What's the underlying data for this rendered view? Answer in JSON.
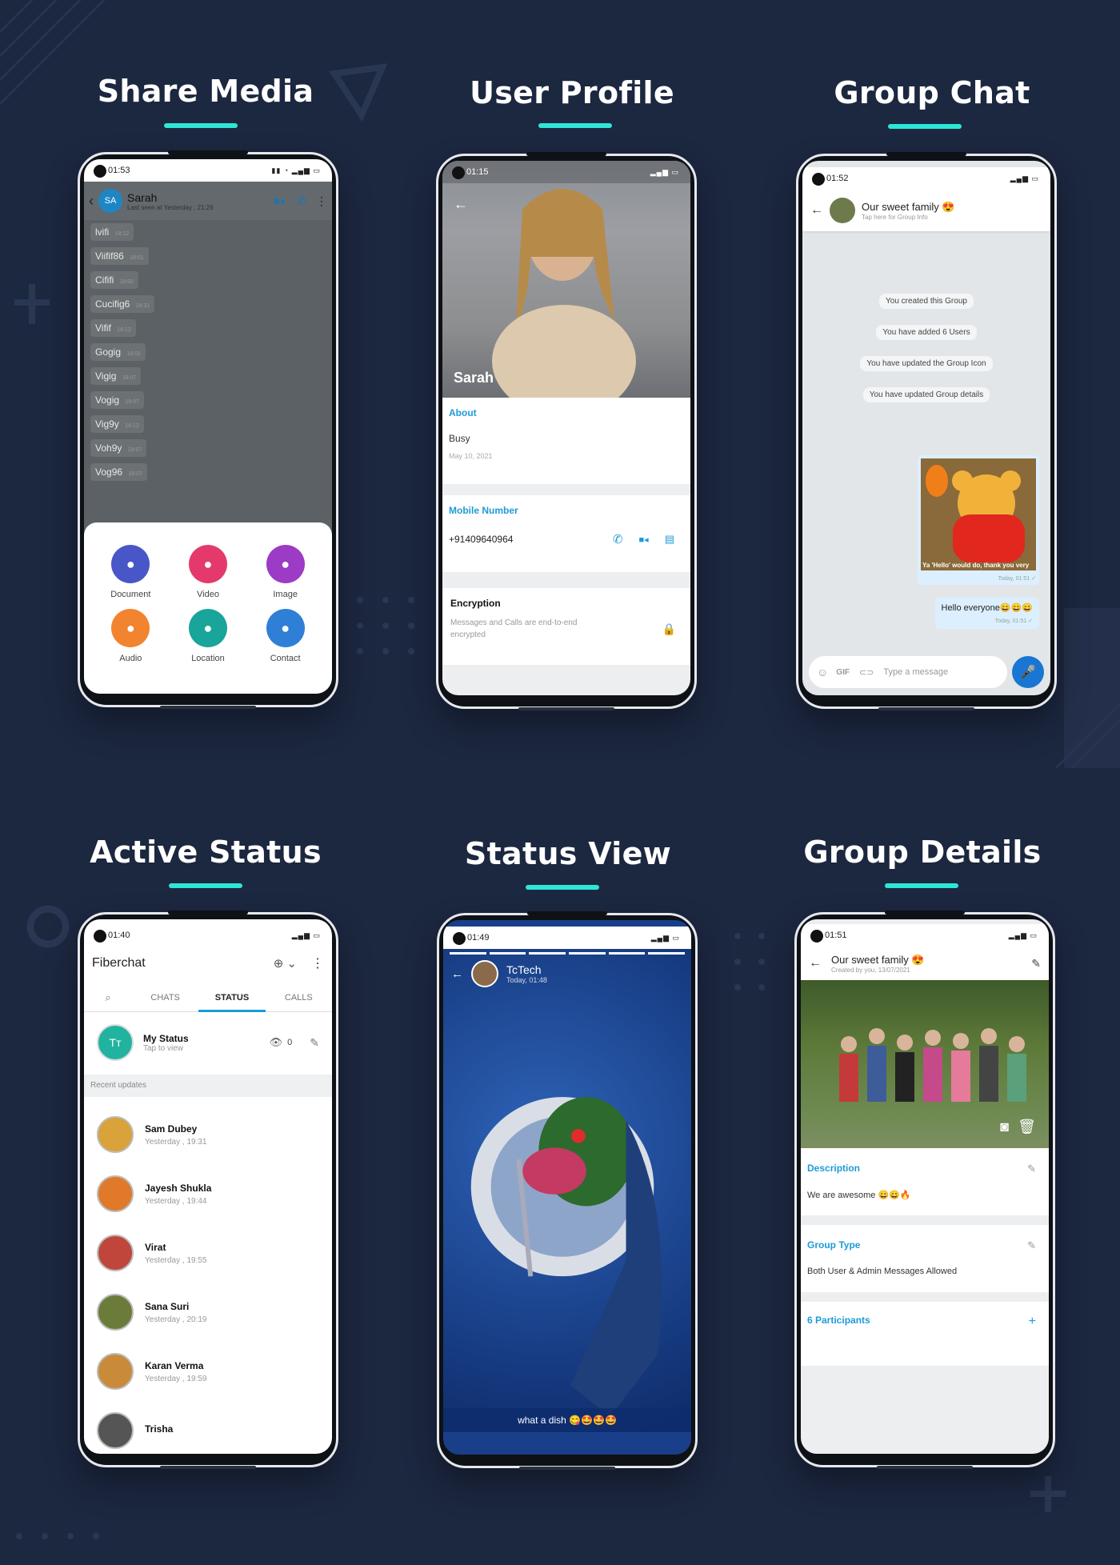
{
  "sections": {
    "share_media": "Share Media",
    "user_profile": "User Profile",
    "group_chat": "Group Chat",
    "active_status": "Active Status",
    "status_view": "Status View",
    "group_details": "Group Details"
  },
  "colors": {
    "background": "#1c2740",
    "accent_bar": "#2ee6d6",
    "app_blue": "#1e9bd7",
    "fab_blue": "#1976d2"
  },
  "share": {
    "time": "01:53",
    "avatar": "SA",
    "name": "Sarah",
    "last_seen": "Last seen at Yesterday , 21:26",
    "messages": [
      {
        "text": "lvifi",
        "time": "18:12"
      },
      {
        "text": "Viifif86",
        "time": "18:01"
      },
      {
        "text": "Cififi",
        "time": "18:02"
      },
      {
        "text": "Cucifig6",
        "time": "18:31"
      },
      {
        "text": "Vifif",
        "time": "18:12"
      },
      {
        "text": "Gogig",
        "time": "18:01"
      },
      {
        "text": "Vigig",
        "time": "18:07"
      },
      {
        "text": "Vogig",
        "time": "18:07"
      },
      {
        "text": "Vig9y",
        "time": "18:12"
      },
      {
        "text": "Voh9y",
        "time": "18:07"
      },
      {
        "text": "Vog96",
        "time": "18:07"
      }
    ],
    "attachments": [
      {
        "label": "Document",
        "icon": "document-icon",
        "color": "#4856c8"
      },
      {
        "label": "Video",
        "icon": "video-icon",
        "color": "#e43a6b"
      },
      {
        "label": "Image",
        "icon": "image-icon",
        "color": "#9c3bc6"
      },
      {
        "label": "Audio",
        "icon": "microphone-icon",
        "color": "#f2832f"
      },
      {
        "label": "Location",
        "icon": "location-pin-icon",
        "color": "#1aa59b"
      },
      {
        "label": "Contact",
        "icon": "contact-icon",
        "color": "#2f7fd6"
      }
    ]
  },
  "profile": {
    "time": "01:15",
    "name": "Sarah",
    "about_label": "About",
    "about_value": "Busy",
    "about_date": "May 10, 2021",
    "mobile_label": "Mobile Number",
    "mobile_value": "+91409640964",
    "encryption_label": "Encryption",
    "encryption_text": "Messages and Calls are end-to-end encrypted"
  },
  "group_chat": {
    "time": "01:52",
    "title": "Our sweet family 😍",
    "subtitle": "Tap here for Group Info",
    "events": [
      "You created this Group",
      "You have added 6 Users",
      "You have updated the Group Icon",
      "You have updated Group details"
    ],
    "image_caption": "Ya 'Hello' would do, thank you very",
    "image_time": "Today, 01:51 ✓",
    "message": "Hello everyone😄😄😄",
    "message_time": "Today, 01:51 ✓",
    "input_placeholder": "Type a message",
    "gif_label": "GIF"
  },
  "active": {
    "time": "01:40",
    "app_name": "Fiberchat",
    "tabs": [
      "CHATS",
      "STATUS",
      "CALLS"
    ],
    "my_status": "My Status",
    "my_status_sub": "Tap to view",
    "views": "0",
    "my_avatar": "Tт",
    "recent_label": "Recent updates",
    "updates": [
      {
        "name": "Sam Dubey",
        "time": "Yesterday ,  19:31",
        "color": "#d9a23a"
      },
      {
        "name": "Jayesh Shukla",
        "time": "Yesterday ,  19:44",
        "color": "#e07a2a"
      },
      {
        "name": "Virat",
        "time": "Yesterday ,  19:55",
        "color": "#c0463c"
      },
      {
        "name": "Sana Suri",
        "time": "Yesterday ,  20:19",
        "color": "#6b7b3a"
      },
      {
        "name": "Karan Verma",
        "time": "Yesterday ,  19:59",
        "color": "#c98a3a"
      },
      {
        "name": "Trisha",
        "time": "",
        "color": "#555"
      }
    ]
  },
  "status_view": {
    "time": "01:49",
    "name": "TcTech",
    "time_sub": "Today, 01:48",
    "caption": "what a dish 😋🤩🤩🤩"
  },
  "group_details": {
    "time": "01:51",
    "title": "Our sweet family 😍",
    "subtitle": "Created by you, 13/07/2021",
    "description_label": "Description",
    "description_value": "We are awesome 😄😄🔥",
    "type_label": "Group Type",
    "type_value": "Both User & Admin Messages Allowed",
    "participants_label": "6 Participants"
  }
}
